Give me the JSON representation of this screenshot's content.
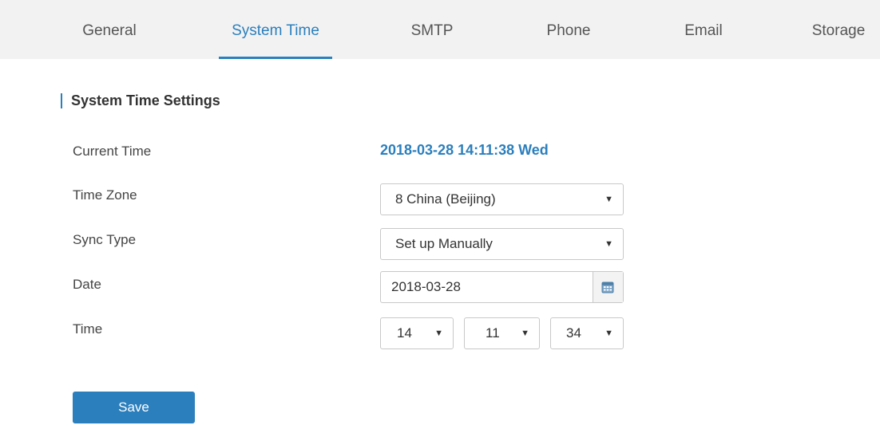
{
  "tabs": [
    {
      "label": "General",
      "active": false
    },
    {
      "label": "System Time",
      "active": true
    },
    {
      "label": "SMTP",
      "active": false
    },
    {
      "label": "Phone",
      "active": false
    },
    {
      "label": "Email",
      "active": false
    },
    {
      "label": "Storage",
      "active": false
    }
  ],
  "section": {
    "title": "System Time Settings"
  },
  "form": {
    "current_time": {
      "label": "Current Time",
      "value": "2018-03-28 14:11:38 Wed"
    },
    "time_zone": {
      "label": "Time Zone",
      "value": "8 China (Beijing)"
    },
    "sync_type": {
      "label": "Sync Type",
      "value": "Set up Manually"
    },
    "date": {
      "label": "Date",
      "value": "2018-03-28"
    },
    "time": {
      "label": "Time",
      "hour": "14",
      "minute": "11",
      "second": "34"
    }
  },
  "save_label": "Save",
  "colors": {
    "accent": "#2b7fbd",
    "tab_bar_bg": "#f2f2f2"
  },
  "icons": {
    "dropdown": "caret-down-icon",
    "calendar": "calendar-icon"
  }
}
